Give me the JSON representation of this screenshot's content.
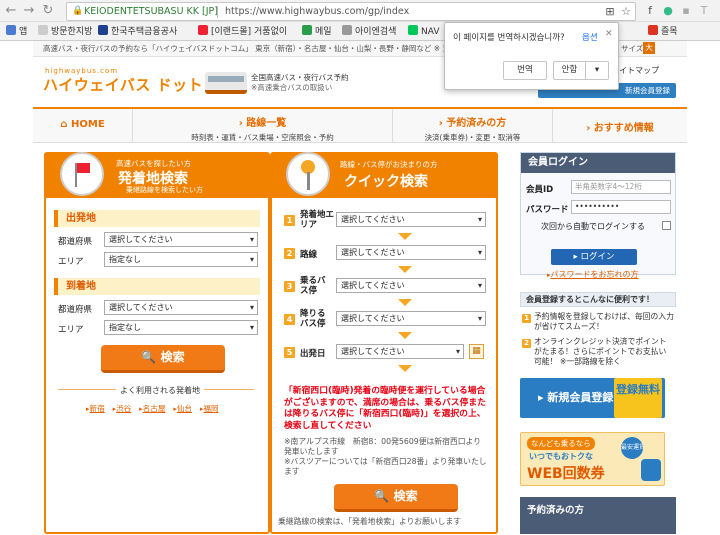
{
  "browser": {
    "cert": "KEIODENTETSUBASU KK [JP]",
    "url": "https://www.highwaybus.com/gp/index",
    "bookmarks": [
      "앱",
      "방문한지방",
      "한국주택금융공사",
      "[이랜드몰] 거품없이",
      "메일",
      "아이엔검색",
      "NAV",
      "즐목"
    ],
    "popup": {
      "question": "이 페이지를 번역하시겠습니까?",
      "options": "옵션",
      "translate": "번역",
      "decline": "안함"
    }
  },
  "site": {
    "topstrip": "高速バス・夜行バスの予約なら「ハイウェイバスドットコム」 東京（新宿）・名古屋・仙台・山梨・長野・静岡など ※ 当サ",
    "size_label": "サイズ",
    "size_value": "大",
    "logo_small": "highwaybus.com",
    "logo": "ハイウェイバス ドットコム",
    "tagline": [
      "全国高速バス・夜行バス予約",
      "※高速乗合バスの取扱い"
    ],
    "sitemap": "サイトマップ",
    "member_btn": "新規会員登録",
    "nav": [
      {
        "title": "HOME",
        "sub": ""
      },
      {
        "title": "路線一覧",
        "sub": "時刻表・運賃・バス乗場・空席照会・予約"
      },
      {
        "title": "予約済みの方",
        "sub": "決済(乗車券)・変更・取消等"
      },
      {
        "title": "おすすめ情報",
        "sub": ""
      }
    ],
    "left": {
      "head_small": "高速バスを探したい方",
      "head_big": "発着地検索",
      "head_sub": "乗継路線を検索したい方",
      "dep": "出発地",
      "arr": "到着地",
      "pref": "都道府県",
      "area": "エリア",
      "pref_value": "選択してください",
      "area_value": "指定なし",
      "search": "検索",
      "frequent": "よく利用される発着地",
      "places": [
        "新宿",
        "渋谷",
        "名古屋",
        "仙台",
        "福岡"
      ]
    },
    "middle": {
      "head_small": "路線・バス停がお決まりの方",
      "head_big": "クイック検索",
      "rows": [
        {
          "num": "1",
          "label": "発着地エリア",
          "value": "選択してください"
        },
        {
          "num": "2",
          "label": "路線",
          "value": "選択してください"
        },
        {
          "num": "3",
          "label": "乗るバス停",
          "value": "選択してください"
        },
        {
          "num": "4",
          "label": "降りるバス停",
          "value": "選択してください"
        },
        {
          "num": "5",
          "label": "出発日",
          "value": "選択してください"
        }
      ],
      "notice_red": "「新宿西口(臨時)発着の臨時便を運行している場合がございますので、満席の場合は、乗るバス停または降りるバス停に「新宿西口(臨時)」を選択の上、検索し直してください",
      "notice_gray": "※南アルプス市線　新宿8：00発5609便は新宿西口より発車いたします\n※バスツアーについては「新宿西口28番」より発車いたします",
      "search": "検索",
      "footer": "乗継路線の検索は、「発着地検索」よりお願いします"
    },
    "right": {
      "login_title": "会員ログイン",
      "id_label": "会員ID",
      "id_placeholder": "半角英数字4～12桁",
      "pw_label": "パスワード",
      "pw_value": "••••••••••",
      "auto_login": "次回から自動でログインする",
      "login_btn": "ログイン",
      "forgot": "パスワードをお忘れの方",
      "benefit_title": "会員登録するとこんなに便利です！",
      "benefits": [
        "予約情報を登録しておけば、毎回の入力が省けてスムーズ！",
        "オンラインクレジット決済でポイントがたまる！さらにポイントでお支払い可能！ ※一部路線を除く"
      ],
      "register": "新規会員登録",
      "register_free": "登録無料",
      "web_ad_top": "なんども乗るなら",
      "web_ad_mid": "いつでもおトクな",
      "web_ad_big": "WEB回数券",
      "web_ad_badge": "最安運賃",
      "reserved": "予約済みの方"
    }
  }
}
